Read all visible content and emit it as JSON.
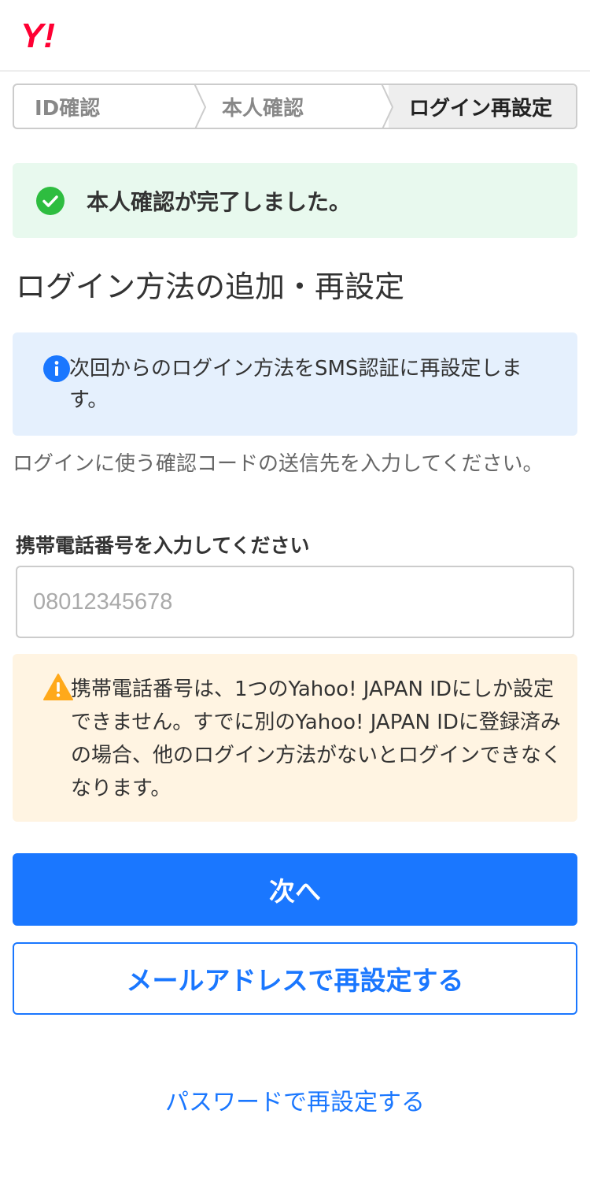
{
  "brand": {
    "logo_text": "Y!",
    "logo_color": "#ff0033",
    "icon": "yahoo-logo"
  },
  "steps": [
    {
      "label": "ID確認",
      "active": false
    },
    {
      "label": "本人確認",
      "active": false
    },
    {
      "label": "ログイン再設定",
      "active": true
    }
  ],
  "success": {
    "message": "本人確認が完了しました。",
    "icon": "check-circle-icon",
    "color": "#2ebd40"
  },
  "page_title": "ログイン方法の追加・再設定",
  "info": {
    "icon": "info-icon",
    "text": "次回からのログイン方法をSMS認証に再設定します。"
  },
  "instruction": "ログインに使う確認コードの送信先を入力してください。",
  "phone_field": {
    "label": "携帯電話番号を入力してください",
    "placeholder": "08012345678",
    "value": ""
  },
  "warning": {
    "icon": "warning-icon",
    "text": "携帯電話番号は、1つのYahoo! JAPAN IDにしか設定できません。すでに別のYahoo! JAPAN IDに登録済みの場合、他のログイン方法がないとログインできなくなります。"
  },
  "buttons": {
    "next": "次へ",
    "email_reset": "メールアドレスで再設定する"
  },
  "password_link": "パスワードで再設定する",
  "colors": {
    "accent": "#1a77ff",
    "success_bg": "#e8f9ee",
    "info_bg": "#e5f0fd",
    "warning_bg": "#fff4e2",
    "warning_icon": "#ffa91a"
  }
}
